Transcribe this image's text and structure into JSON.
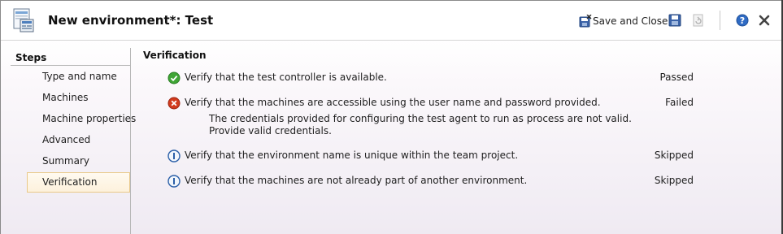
{
  "header": {
    "title": "New environment*: Test",
    "save_close_label": "Save and Close",
    "icons": [
      "environment-app-icon",
      "save-and-close-icon",
      "save-icon",
      "refresh-icon",
      "help-icon",
      "close-icon"
    ]
  },
  "steps": {
    "title": "Steps",
    "items": [
      {
        "label": "Type and name"
      },
      {
        "label": "Machines"
      },
      {
        "label": "Machine properties"
      },
      {
        "label": "Advanced"
      },
      {
        "label": "Summary"
      },
      {
        "label": "Verification",
        "selected": true
      }
    ]
  },
  "verification": {
    "title": "Verification",
    "checks": [
      {
        "icon": "passed-check-icon",
        "text": "Verify that the test controller is available.",
        "status": "Passed"
      },
      {
        "icon": "failed-x-icon",
        "text": "Verify that the machines are accessible using the user name and password provided.",
        "status": "Failed",
        "detail": "The credentials provided for configuring the test agent to run as process are not valid. Provide valid credentials."
      },
      {
        "icon": "skipped-info-icon",
        "text": "Verify that the environment name is unique within the team project.",
        "status": "Skipped"
      },
      {
        "icon": "skipped-info-icon",
        "text": "Verify that the machines are not already part of another environment.",
        "status": "Skipped"
      }
    ]
  },
  "colors": {
    "passed": "#3fa535",
    "failed": "#d23a1c",
    "info": "#2b5fa8",
    "selection_border": "#e9c98a"
  }
}
